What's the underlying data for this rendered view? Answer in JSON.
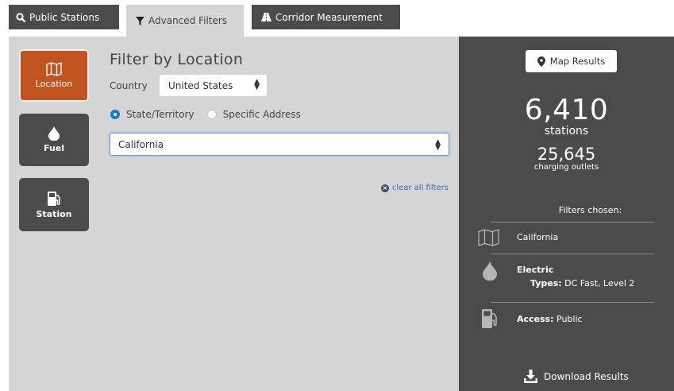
{
  "tabs": [
    {
      "label": "Public Stations",
      "icon": "search-icon"
    },
    {
      "label": "Advanced Filters",
      "icon": "filter-icon"
    },
    {
      "label": "Corridor Measurement",
      "icon": "road-icon"
    }
  ],
  "categories": [
    {
      "label": "Location",
      "icon": "map-icon"
    },
    {
      "label": "Fuel",
      "icon": "drop-icon"
    },
    {
      "label": "Station",
      "icon": "fuel-pump-icon"
    }
  ],
  "filter": {
    "title": "Filter by Location",
    "country_label": "Country",
    "country_value": "United States",
    "radio_state": "State/Territory",
    "radio_address": "Specific Address",
    "state_value": "California",
    "clear_label": "clear all filters"
  },
  "results": {
    "map_button": "Map Results",
    "stations_count": "6,410",
    "stations_label": "stations",
    "outlets_count": "25,645",
    "outlets_label": "charging outlets",
    "filters_title": "Filters chosen:",
    "location_value": "California",
    "fuel_value": "Electric",
    "types_label": "Types:",
    "types_value": "DC Fast, Level 2",
    "access_label": "Access:",
    "access_value": "Public",
    "download_label": "Download Results"
  },
  "colors": {
    "accent": "#c0531f",
    "dark": "#4b4b4b",
    "panel": "#d5d5d5",
    "link": "#2c6fb5"
  }
}
